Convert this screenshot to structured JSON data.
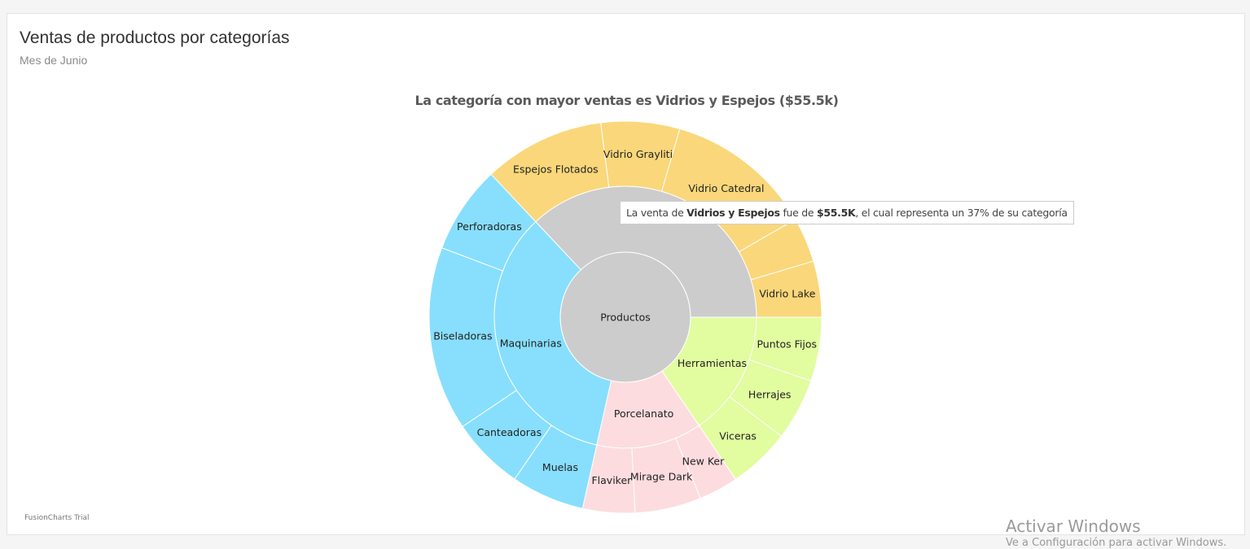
{
  "card": {
    "title": "Ventas de productos por categorías",
    "subtitle": "Mes de Junio"
  },
  "chart_data": {
    "type": "sunburst",
    "caption": "La categoría con mayor ventas es Vidrios y Espejos ($55.5k)",
    "root": {
      "label": "Productos",
      "color": "#cccccc"
    },
    "categories": [
      {
        "label": "",
        "color": "#cccccc",
        "leaf_color": "#fad77a",
        "share": 0.37,
        "children": [
          {
            "label": "Vidrio Lake",
            "share": 0.125
          },
          {
            "label": "",
            "share": 0.1
          },
          {
            "label": "Vidrio Catedral",
            "share": 0.33
          },
          {
            "label": "Vidrio Grayliti",
            "share": 0.175
          },
          {
            "label": "Espejos Flotados",
            "share": 0.27
          }
        ]
      },
      {
        "label": "Maquinarias",
        "color": "#87dffd",
        "leaf_color": "#87dffd",
        "share": 0.345,
        "children": [
          {
            "label": "Perforadoras",
            "share": 0.21
          },
          {
            "label": "Biseladoras",
            "share": 0.44
          },
          {
            "label": "Canteadoras",
            "share": 0.175
          },
          {
            "label": "Muelas",
            "share": 0.175
          }
        ]
      },
      {
        "label": "Porcelanato",
        "color": "#fddce0",
        "leaf_color": "#fddce0",
        "share": 0.13,
        "children": [
          {
            "label": "Flaviker",
            "share": 0.33
          },
          {
            "label": "Mirage Dark",
            "share": 0.42
          },
          {
            "label": "New Ker",
            "share": 0.25
          }
        ]
      },
      {
        "label": "Herramientas",
        "color": "#e2fca0",
        "leaf_color": "#e2fca0",
        "share": 0.155,
        "children": [
          {
            "label": "Viceras",
            "share": 0.33
          },
          {
            "label": "Herrajes",
            "share": 0.33
          },
          {
            "label": "Puntos Fijos",
            "share": 0.34
          }
        ]
      }
    ]
  },
  "tooltip": {
    "prefix": "La venta de ",
    "category": "Vidrios y Espejos",
    "middle": " fue de ",
    "amount": "$55.5K",
    "suffix": ", el cual representa un 37% de su categoría"
  },
  "footer": {
    "trial_text": "FusionCharts Trial"
  },
  "watermark": {
    "title": "Activar Windows",
    "subtitle": "Ve a Configuración para activar Windows."
  }
}
